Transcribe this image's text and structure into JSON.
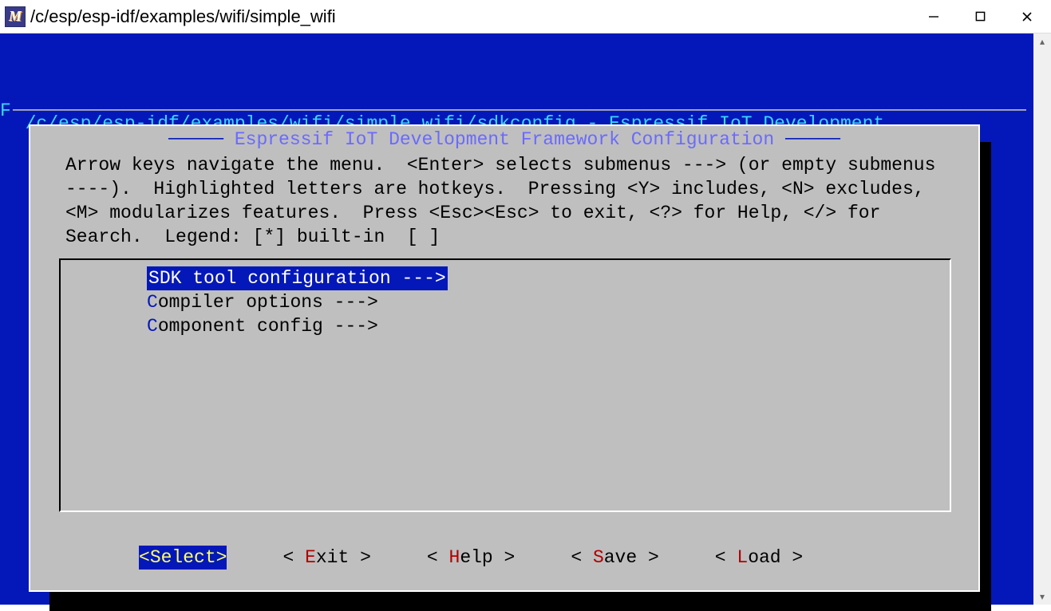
{
  "window": {
    "icon_text": "M",
    "title": "/c/esp/esp-idf/examples/wifi/simple_wifi"
  },
  "terminal": {
    "header_path": "/c/esp/esp-idf/examples/wifi/simple_wifi/sdkconfig - Espressif IoT Development",
    "header_prefix_char": "F",
    "dialog_title": "Espressif IoT Development Framework Configuration",
    "instructions": "Arrow keys navigate the menu.  <Enter> selects submenus ---> (or empty submenus ----).  Highlighted letters are hotkeys.  Pressing <Y> includes, <N> excludes, <M> modularizes features.  Press <Esc><Esc> to exit, <?> for Help, </> for Search.  Legend: [*] built-in  [ ]",
    "menu": [
      {
        "hotkey": "S",
        "rest": "DK tool configuration  --->",
        "selected": true
      },
      {
        "hotkey": "C",
        "rest": "ompiler options  --->",
        "selected": false
      },
      {
        "hotkey": "C",
        "rest": "omponent config  --->",
        "selected": false
      }
    ],
    "buttons": [
      {
        "pre": "<",
        "hk": "S",
        "post": "elect>",
        "selected": true
      },
      {
        "pre": "< ",
        "hk": "E",
        "post": "xit >",
        "selected": false
      },
      {
        "pre": "< ",
        "hk": "H",
        "post": "elp >",
        "selected": false
      },
      {
        "pre": "< ",
        "hk": "S",
        "post": "ave >",
        "selected": false
      },
      {
        "pre": "< ",
        "hk": "L",
        "post": "oad >",
        "selected": false
      }
    ]
  }
}
